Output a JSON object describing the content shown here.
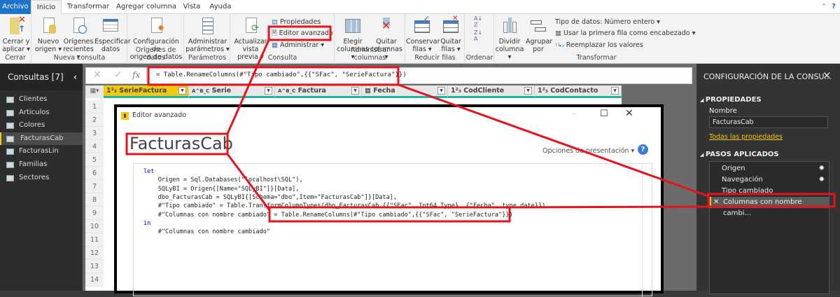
{
  "tabs": [
    "Archivo",
    "Inicio",
    "Transformar",
    "Agregar columna",
    "Vista",
    "Ayuda"
  ],
  "ribbon": {
    "groups": {
      "cerrar": "Cerrar",
      "nueva": "Nueva consulta",
      "origenes": "Orígenes de datos",
      "parametros": "Parámetros",
      "consulta": "Consulta",
      "admcols": "Administrar columnas",
      "reducir": "Reducir filas",
      "ordenar": "Ordenar",
      "transformar": "Transformar"
    },
    "cerrar_aplicar": [
      "Cerrar y",
      "aplicar ▾"
    ],
    "nuevo_origen": [
      "Nuevo",
      "origen ▾"
    ],
    "origenes_recientes": [
      "Orígenes",
      "recientes ▾"
    ],
    "especificar": [
      "Especificar",
      "datos"
    ],
    "config_origen": [
      "Configuración de",
      "origen de datos"
    ],
    "admin_param": [
      "Administrar",
      "parámetros ▾"
    ],
    "actualizar": [
      "Actualizar",
      "vista previa ▾"
    ],
    "propiedades": "Propiedades",
    "editor_avanzado": "Editor avanzado",
    "administrar": "Administrar ▾",
    "elegir": [
      "Elegir",
      "columnas ▾"
    ],
    "quitar_cols": [
      "Quitar",
      "columnas ▾"
    ],
    "conservar": [
      "Conservar",
      "filas ▾"
    ],
    "quitar_filas": [
      "Quitar",
      "filas ▾"
    ],
    "dividir": [
      "Dividir",
      "columna ▾"
    ],
    "agrupar": [
      "Agrupar",
      "por"
    ],
    "tipo_datos": "Tipo de datos: Número entero ▾",
    "primera_fila": "Usar la primera fila como encabezado ▾",
    "reemplazar": "Reemplazar los valores"
  },
  "queries": {
    "title": "Consultas [7]",
    "items": [
      "Clientes",
      "Articulos",
      "Colores",
      "FacturasCab",
      "FacturasLin",
      "Familias",
      "Sectores"
    ],
    "selected": "FacturasCab"
  },
  "formula": "= Table.RenameColumns(#\"Tipo cambiado\",{{\"SFac\", \"SerieFactura\"}})",
  "columns": [
    {
      "type": "1²₃",
      "name": "SerieFactura"
    },
    {
      "type": "A^B_C",
      "name": "Serie"
    },
    {
      "type": "A^B_C",
      "name": "Factura"
    },
    {
      "type": "▦",
      "name": "Fecha"
    },
    {
      "type": "1²₃",
      "name": "CodCliente"
    },
    {
      "type": "1²₃",
      "name": "CodContacto"
    }
  ],
  "rows": [
    "1",
    "2",
    "3",
    "4",
    "5",
    "6",
    "7",
    "8",
    "9",
    "10",
    "11",
    "12",
    "13",
    "14"
  ],
  "dialog": {
    "title": "Editor avanzado",
    "query_name": "FacturasCab",
    "options": "Opciones de presentación ▾",
    "code": [
      "let",
      "    Origen = Sql.Databases(\"localhost\\SQL\"),",
      "    SQLyBI = Origen{[Name=\"SQLyBI\"]}[Data],",
      "    dbo_FacturasCab = SQLyBI{[Schema=\"dbo\",Item=\"FacturasCab\"]}[Data],",
      "    #\"Tipo cambiado\" = Table.TransformColumnTypes(dbo_FacturasCab,{{\"SFac\", Int64.Type}, {\"Fecha\", type date}}),",
      "    #\"Columnas con nombre cambiado\" = Table.RenameColumns(#\"Tipo cambiado\",{{\"SFac\", \"SerieFactura\"}})",
      "in",
      "    #\"Columnas con nombre cambiado\""
    ]
  },
  "settings": {
    "title": "CONFIGURACIÓN DE LA CONSU...",
    "properties": "PROPIEDADES",
    "name_label": "Nombre",
    "name_value": "FacturasCab",
    "all_props": "Todas las propiedades",
    "steps_title": "PASOS APLICADOS",
    "steps": [
      "Origen",
      "Navegación",
      "Tipo cambiado",
      "Columnas con nombre cambi..."
    ]
  },
  "colors": {
    "accent": "#f2c811",
    "archivo": "#1e73c8",
    "annotation": "#e3141c",
    "column_bar": "#1fb5a2"
  }
}
